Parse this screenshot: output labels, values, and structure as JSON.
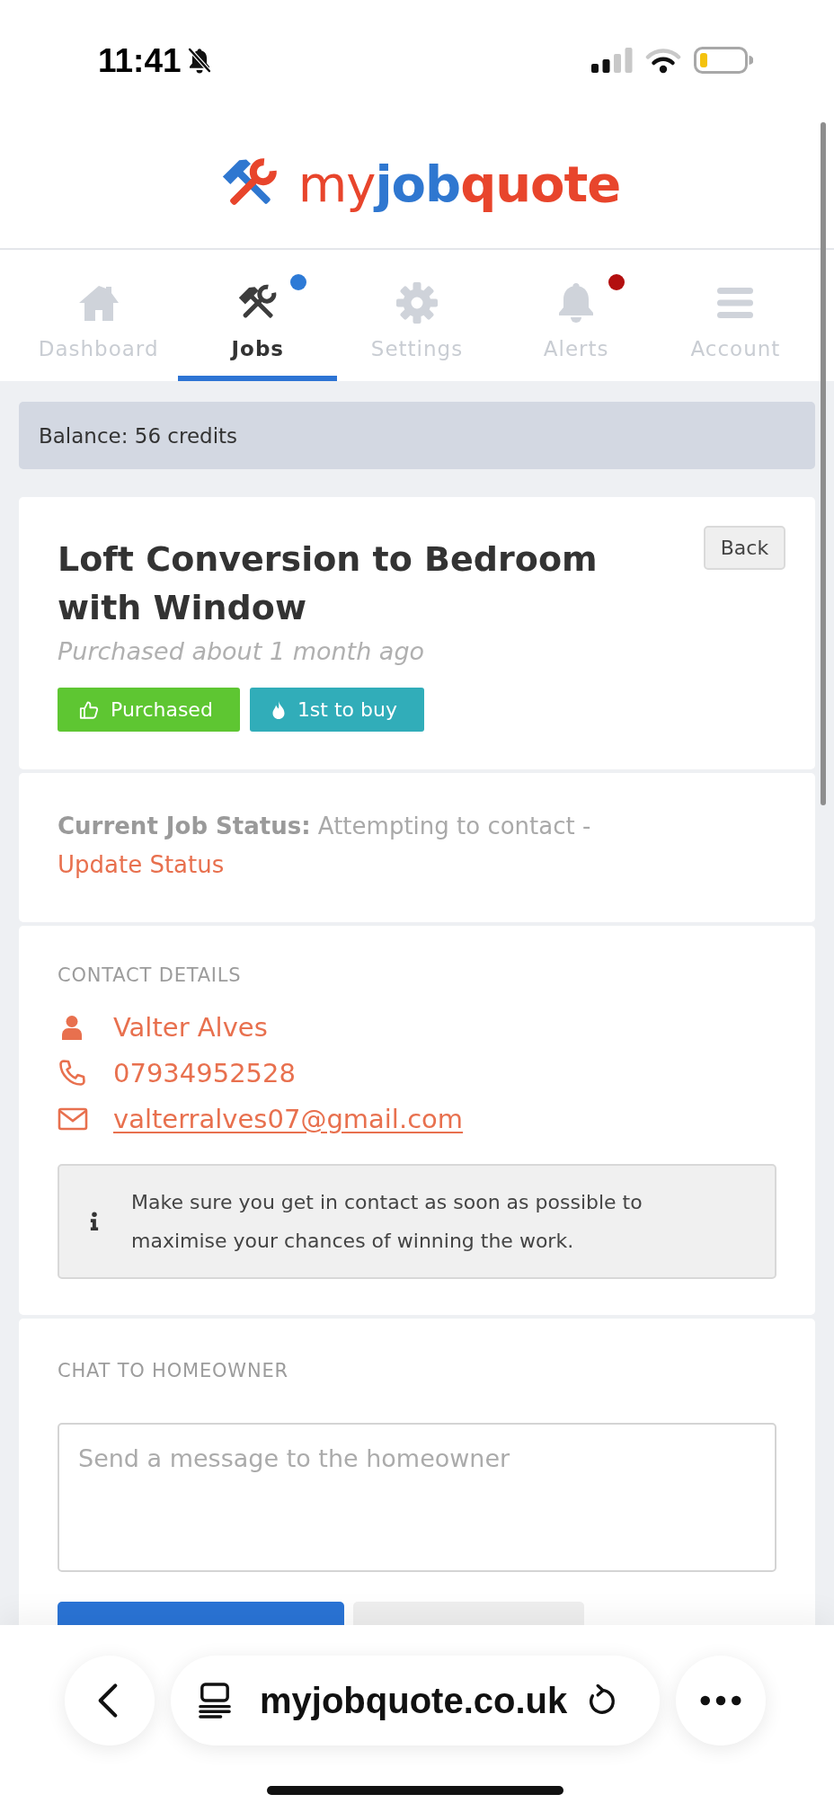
{
  "status_bar": {
    "time": "11:41"
  },
  "logo": {
    "parts": [
      {
        "text": "my",
        "color": "#e8452c"
      },
      {
        "text": "job",
        "color": "#2f77d0"
      },
      {
        "text": "quote",
        "color": "#e8452c"
      }
    ]
  },
  "tabs": [
    {
      "label": "Dashboard",
      "selected": false
    },
    {
      "label": "Jobs",
      "selected": true,
      "badge": {
        "color": "#2d7ad6"
      }
    },
    {
      "label": "Settings",
      "selected": false
    },
    {
      "label": "Alerts",
      "selected": false,
      "badge": {
        "color": "#b30f0f"
      }
    },
    {
      "label": "Account",
      "selected": false
    }
  ],
  "balance": "Balance: 56 credits",
  "job": {
    "title": "Loft Conversion to Bedroom with Window",
    "subtitle": "Purchased about 1 month ago",
    "back_button": "Back",
    "badges": [
      {
        "label": "Purchased",
        "color": "#5ec632"
      },
      {
        "label": "1st to buy",
        "color": "#31adb9"
      }
    ]
  },
  "status": {
    "text": "**Current Job Status:** Attempting to contact -",
    "link": "Update Status"
  },
  "contact": {
    "heading": "CONTACT DETAILS",
    "items": [
      {
        "kind": "person",
        "text": "Valter Alves"
      },
      {
        "kind": "phone",
        "text": "07934952528"
      },
      {
        "kind": "email",
        "text": "valterralves07@gmail.com"
      }
    ],
    "notice": "Make sure you get in contact as soon as possible to maximise your chances of winning the work."
  },
  "chat": {
    "heading": "CHAT TO HOMEOWNER",
    "placeholder": "Send a message to the homeowner"
  },
  "browser": {
    "url": "myjobquote.co.uk"
  }
}
